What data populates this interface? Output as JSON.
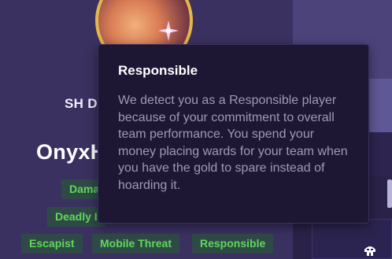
{
  "profile": {
    "name": "OnyxH",
    "tags": [
      {
        "label": "Dama"
      },
      {
        "label": "Deadly I"
      },
      {
        "label": "Escapist"
      },
      {
        "label": "Mobile Threat"
      },
      {
        "label": "Responsible"
      }
    ]
  },
  "right_panel": {
    "bar_label": "SH DA"
  },
  "tooltip": {
    "title": "Responsible",
    "body": "We detect you as a Responsible player because of your commitment to overall team performance. You spend your money placing wards for your team when you have the gold to spare instead of hoarding it."
  },
  "colors": {
    "tag_text": "#5fd85a",
    "tag_bg": "#2f4a46",
    "avatar_border": "#e3b84a",
    "tooltip_bg": "#1d1734"
  },
  "icons": {
    "corner": "helmet-icon",
    "avatar_sparkle": "sparkle-icon"
  }
}
